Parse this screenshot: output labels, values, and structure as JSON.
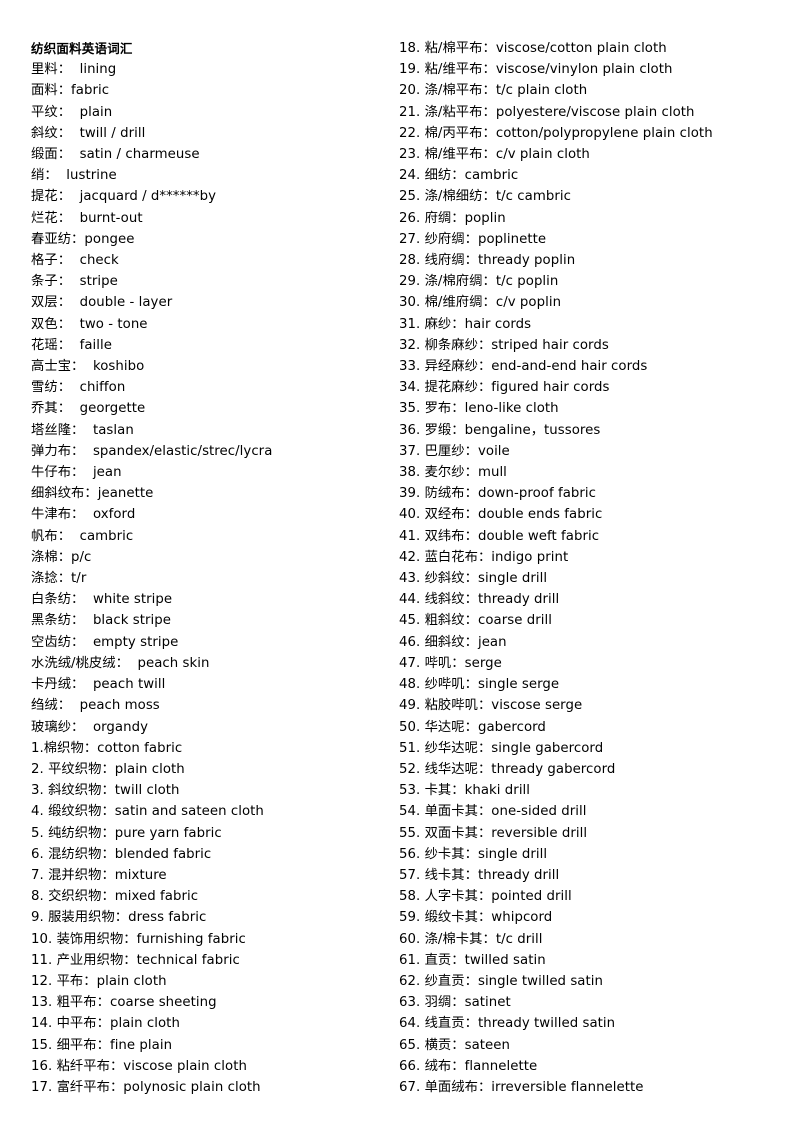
{
  "document": {
    "title": "纺织面料英语词汇",
    "left_column": [
      "里料：  lining",
      "面料：fabric",
      "平纹：  plain",
      "斜纹：  twill / drill",
      "缎面：  satin / charmeuse",
      "绡：  lustrine",
      "提花：  jacquard / d******by",
      "烂花：  burnt-out",
      "春亚纺：pongee",
      "格子：  check",
      "条子：  stripe",
      "双层：  double - layer",
      "双色：  two - tone",
      "花瑶：  faille",
      "高士宝：  koshibo",
      "雪纺：  chiffon",
      "乔其：  georgette",
      "塔丝隆：  taslan",
      "弹力布：  spandex/elastic/strec/lycra",
      "牛仔布：  jean",
      "细斜纹布：jeanette",
      "牛津布：  oxford",
      "帆布：  cambric",
      "涤棉：p/c",
      "涤捻：t/r",
      "白条纺：  white stripe",
      "黑条纺：  black stripe",
      "空齿纺：  empty stripe",
      "水洗绒/桃皮绒：  peach skin",
      "卡丹绒：  peach twill",
      "绉绒：  peach moss",
      "玻璃纱：  organdy",
      "1.棉织物：cotton fabric",
      "2. 平纹织物：plain cloth",
      "3. 斜纹织物：twill cloth",
      "4. 缎纹织物：satin and sateen cloth",
      "5. 纯纺织物：pure yarn fabric",
      "6. 混纺织物：blended fabric",
      "7. 混并织物：mixture",
      "8. 交织织物：mixed fabric",
      "9. 服装用织物：dress fabric",
      "10. 装饰用织物：furnishing fabric",
      "11. 产业用织物：technical fabric",
      "12. 平布：plain cloth",
      "13. 粗平布：coarse sheeting",
      "14. 中平布：plain cloth",
      "15. 细平布：fine plain",
      "16. 粘纤平布：viscose plain cloth",
      "17. 富纤平布：polynosic plain cloth"
    ],
    "right_column": [
      "18. 粘/棉平布：viscose/cotton plain cloth",
      "19. 粘/维平布：viscose/vinylon plain cloth",
      "20. 涤/棉平布：t/c plain cloth",
      "21. 涤/粘平布：polyestere/viscose plain cloth",
      "22. 棉/丙平布：cotton/polypropylene plain cloth",
      "23. 棉/维平布：c/v plain cloth",
      "24. 细纺：cambric",
      "25. 涤/棉细纺：t/c cambric",
      "26. 府绸：poplin",
      "27. 纱府绸：poplinette",
      "28. 线府绸：thready poplin",
      "29. 涤/棉府绸：t/c poplin",
      "30. 棉/维府绸：c/v poplin",
      "31. 麻纱：hair cords",
      "32. 柳条麻纱：striped hair cords",
      "33. 异经麻纱：end-and-end hair cords",
      "34. 提花麻纱：figured hair cords",
      "35. 罗布：leno-like cloth",
      "36. 罗缎：bengaline，tussores",
      "37. 巴厘纱：voile",
      "38. 麦尔纱：mull",
      "39. 防绒布：down-proof fabric",
      "40. 双经布：double ends fabric",
      "41. 双纬布：double weft fabric",
      "42. 蓝白花布：indigo print",
      "43. 纱斜纹：single drill",
      "44. 线斜纹：thready drill",
      "45. 粗斜纹：coarse drill",
      "46. 细斜纹：jean",
      "47. 哔叽：serge",
      "48. 纱哔叽：single serge",
      "49. 粘胶哔叽：viscose serge",
      "50. 华达呢：gabercord",
      "51. 纱华达呢：single gabercord",
      "52. 线华达呢：thready gabercord",
      "53. 卡其：khaki drill",
      "54. 单面卡其：one-sided drill",
      "55. 双面卡其：reversible drill",
      "56. 纱卡其：single drill",
      "57. 线卡其：thready drill",
      "58. 人字卡其：pointed drill",
      "59. 缎纹卡其：whipcord",
      "60. 涤/棉卡其：t/c drill",
      "61. 直贡：twilled satin",
      "62. 纱直贡：single twilled satin",
      "63. 羽绸：satinet",
      "64. 线直贡：thready twilled satin",
      "65. 横贡：sateen",
      "66. 绒布：flannelette",
      "67. 单面绒布：irreversible flannelette"
    ]
  }
}
